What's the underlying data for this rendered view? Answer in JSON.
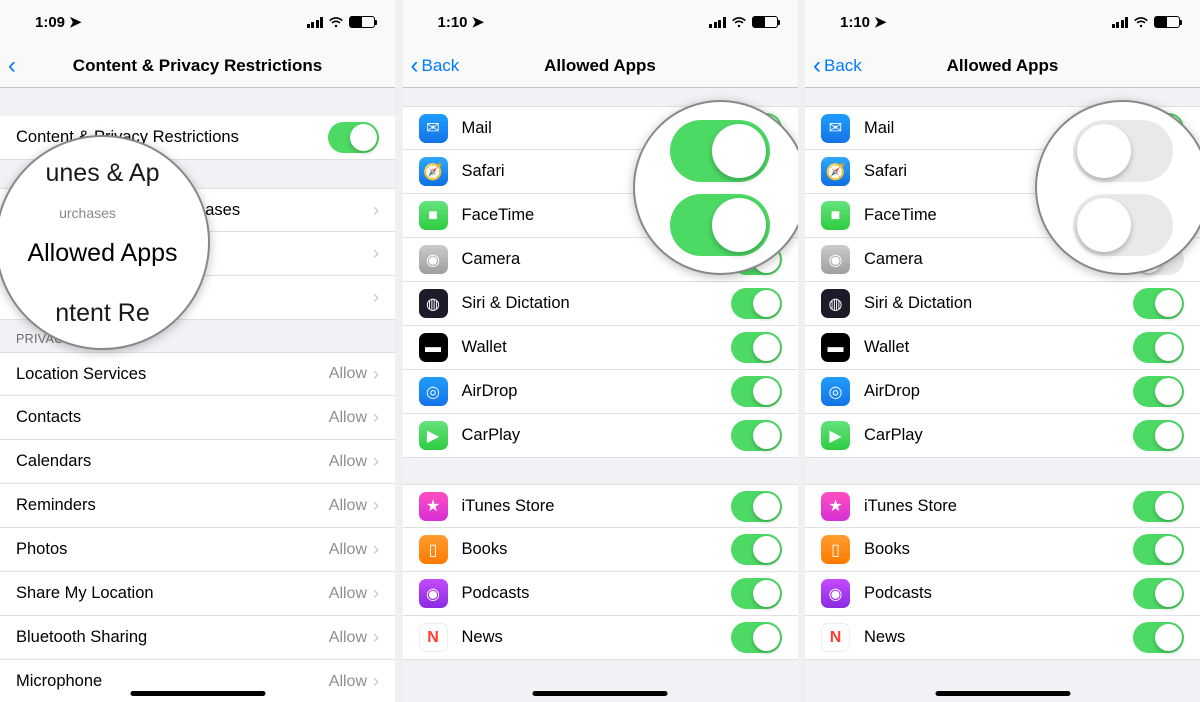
{
  "phones": [
    {
      "time": "1:09",
      "title": "Content & Privacy Restrictions",
      "back_label": "",
      "main_toggle": {
        "label": "Content & Privacy Restrictions",
        "on": true
      },
      "nav_rows": [
        {
          "label": "iTunes & App Store Purchases"
        },
        {
          "label": "Allowed Apps"
        },
        {
          "label": "Content Restrictions"
        }
      ],
      "privacy_header": "PRIVACY",
      "privacy_rows": [
        {
          "label": "Location Services",
          "detail": "Allow"
        },
        {
          "label": "Contacts",
          "detail": "Allow"
        },
        {
          "label": "Calendars",
          "detail": "Allow"
        },
        {
          "label": "Reminders",
          "detail": "Allow"
        },
        {
          "label": "Photos",
          "detail": "Allow"
        },
        {
          "label": "Share My Location",
          "detail": "Allow"
        },
        {
          "label": "Bluetooth Sharing",
          "detail": "Allow"
        },
        {
          "label": "Microphone",
          "detail": "Allow"
        }
      ],
      "magnifier": {
        "line1": "unes & Ap",
        "line2_top": "urchases",
        "line2": "Allowed Apps",
        "line3": "ntent Re"
      }
    },
    {
      "time": "1:10",
      "title": "Allowed Apps",
      "back_label": "Back",
      "groups": [
        [
          {
            "label": "Mail",
            "icon": "ic-mail",
            "glyph": "✉",
            "on": true
          },
          {
            "label": "Safari",
            "icon": "ic-safari",
            "glyph": "🧭",
            "on": true
          },
          {
            "label": "FaceTime",
            "icon": "ic-facetime",
            "glyph": "■",
            "on": true
          },
          {
            "label": "Camera",
            "icon": "ic-camera",
            "glyph": "◉",
            "on": true
          },
          {
            "label": "Siri & Dictation",
            "icon": "ic-siri",
            "glyph": "◍",
            "on": true
          },
          {
            "label": "Wallet",
            "icon": "ic-wallet",
            "glyph": "▬",
            "on": true
          },
          {
            "label": "AirDrop",
            "icon": "ic-airdrop",
            "glyph": "◎",
            "on": true
          },
          {
            "label": "CarPlay",
            "icon": "ic-carplay",
            "glyph": "▶",
            "on": true
          }
        ],
        [
          {
            "label": "iTunes Store",
            "icon": "ic-itunes",
            "glyph": "★",
            "on": true
          },
          {
            "label": "Books",
            "icon": "ic-books",
            "glyph": "▯",
            "on": true
          },
          {
            "label": "Podcasts",
            "icon": "ic-podcasts",
            "glyph": "◉",
            "on": true
          },
          {
            "label": "News",
            "icon": "ic-news",
            "glyph": "N",
            "on": true
          }
        ]
      ]
    },
    {
      "time": "1:10",
      "title": "Allowed Apps",
      "back_label": "Back",
      "groups": [
        [
          {
            "label": "Mail",
            "icon": "ic-mail",
            "glyph": "✉",
            "on": true
          },
          {
            "label": "Safari",
            "icon": "ic-safari",
            "glyph": "🧭",
            "on": false
          },
          {
            "label": "FaceTime",
            "icon": "ic-facetime",
            "glyph": "■",
            "on": true
          },
          {
            "label": "Camera",
            "icon": "ic-camera",
            "glyph": "◉",
            "on": false
          },
          {
            "label": "Siri & Dictation",
            "icon": "ic-siri",
            "glyph": "◍",
            "on": true
          },
          {
            "label": "Wallet",
            "icon": "ic-wallet",
            "glyph": "▬",
            "on": true
          },
          {
            "label": "AirDrop",
            "icon": "ic-airdrop",
            "glyph": "◎",
            "on": true
          },
          {
            "label": "CarPlay",
            "icon": "ic-carplay",
            "glyph": "▶",
            "on": true
          }
        ],
        [
          {
            "label": "iTunes Store",
            "icon": "ic-itunes",
            "glyph": "★",
            "on": true
          },
          {
            "label": "Books",
            "icon": "ic-books",
            "glyph": "▯",
            "on": true
          },
          {
            "label": "Podcasts",
            "icon": "ic-podcasts",
            "glyph": "◉",
            "on": true
          },
          {
            "label": "News",
            "icon": "ic-news",
            "glyph": "N",
            "on": true
          }
        ]
      ]
    }
  ]
}
